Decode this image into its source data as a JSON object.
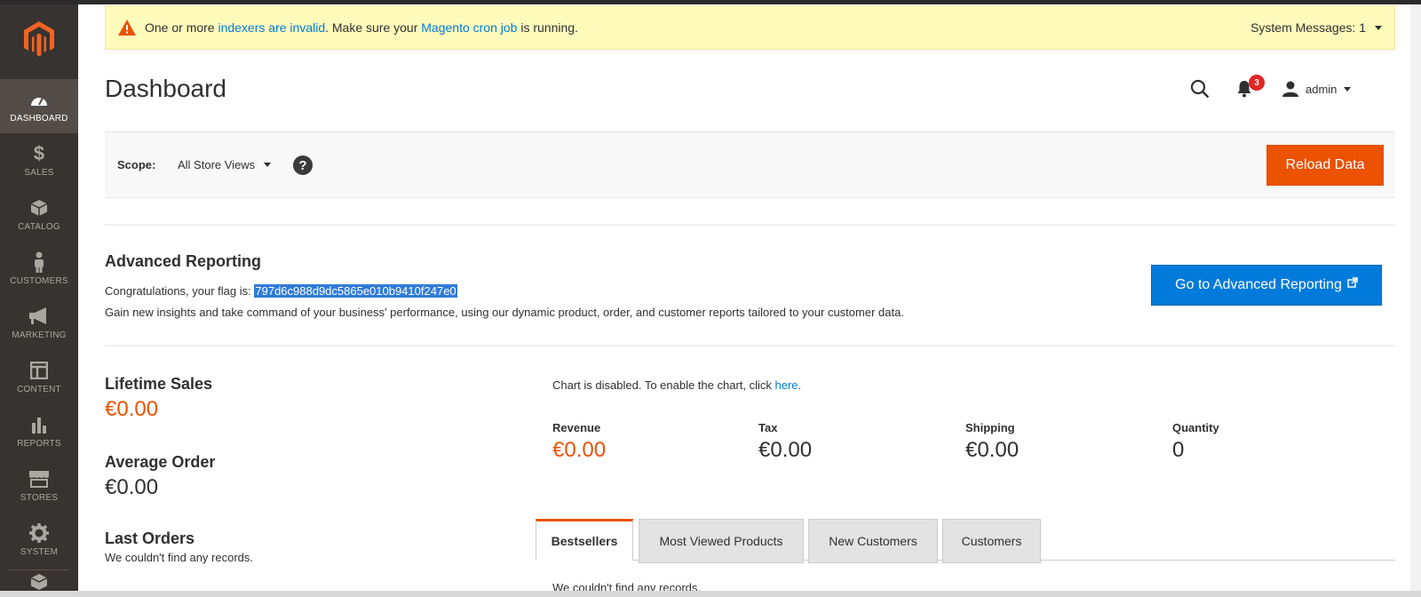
{
  "sidebar": {
    "items": [
      {
        "label": "DASHBOARD",
        "icon": "dashboard-icon",
        "active": true
      },
      {
        "label": "SALES",
        "icon": "dollar-icon"
      },
      {
        "label": "CATALOG",
        "icon": "cube-icon"
      },
      {
        "label": "CUSTOMERS",
        "icon": "person-icon"
      },
      {
        "label": "MARKETING",
        "icon": "megaphone-icon"
      },
      {
        "label": "CONTENT",
        "icon": "layout-icon"
      },
      {
        "label": "REPORTS",
        "icon": "bar-chart-icon"
      },
      {
        "label": "STORES",
        "icon": "storefront-icon"
      },
      {
        "label": "SYSTEM",
        "icon": "gear-icon"
      }
    ]
  },
  "message": {
    "prefix": "One or more ",
    "link1": "indexers are invalid",
    "middle": ". Make sure your ",
    "link2": "Magento cron job",
    "suffix": " is running.",
    "system_messages": "System Messages: 1"
  },
  "header": {
    "title": "Dashboard",
    "notification_count": "3",
    "user": "admin"
  },
  "scope": {
    "label": "Scope:",
    "value": "All Store Views",
    "help": "?",
    "reload_label": "Reload Data"
  },
  "advanced": {
    "title": "Advanced Reporting",
    "congrats": "Congratulations, your flag is: ",
    "flag": "797d6c988d9dc5865e010b9410f247e0",
    "description": "Gain new insights and take command of your business' performance, using our dynamic product, order, and customer reports tailored to your customer data.",
    "button": "Go to Advanced Reporting"
  },
  "stats": {
    "lifetime_label": "Lifetime Sales",
    "lifetime_value": "€0.00",
    "average_label": "Average Order",
    "average_value": "€0.00",
    "last_orders_label": "Last Orders",
    "last_orders_empty": "We couldn't find any records."
  },
  "chart_note": {
    "text": "Chart is disabled. To enable the chart, click ",
    "link": "here",
    "end": "."
  },
  "totals": [
    {
      "label": "Revenue",
      "value": "€0.00"
    },
    {
      "label": "Tax",
      "value": "€0.00"
    },
    {
      "label": "Shipping",
      "value": "€0.00"
    },
    {
      "label": "Quantity",
      "value": "0"
    }
  ],
  "tabs": {
    "items": [
      "Bestsellers",
      "Most Viewed Products",
      "New Customers",
      "Customers"
    ],
    "empty": "We couldn't find anv records."
  },
  "colors": {
    "accent": "#eb5202",
    "link": "#007bdb",
    "sidebar": "#373330"
  }
}
